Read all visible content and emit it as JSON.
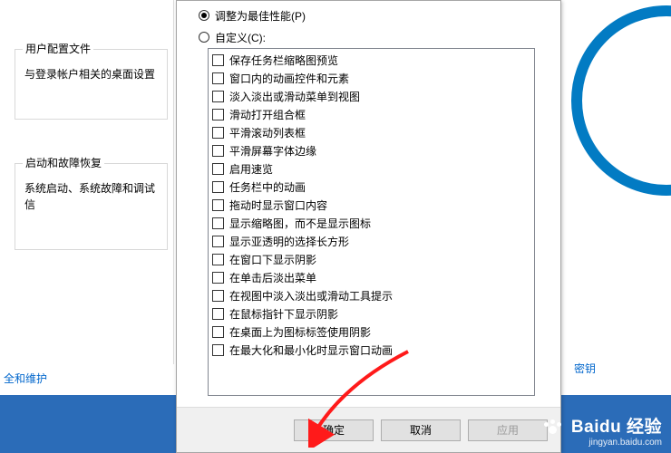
{
  "left": {
    "group1": {
      "title": "用户配置文件",
      "desc": "与登录帐户相关的桌面设置"
    },
    "group2": {
      "title": "启动和故障恢复",
      "desc": "系统启动、系统故障和调试信"
    }
  },
  "dialog": {
    "radios": {
      "best_perf": "调整为最佳性能(P)",
      "custom": "自定义(C):"
    },
    "options": [
      "保存任务栏缩略图预览",
      "窗口内的动画控件和元素",
      "淡入淡出或滑动菜单到视图",
      "滑动打开组合框",
      "平滑滚动列表框",
      "平滑屏幕字体边缘",
      "启用速览",
      "任务栏中的动画",
      "拖动时显示窗口内容",
      "显示缩略图，而不是显示图标",
      "显示亚透明的选择长方形",
      "在窗口下显示阴影",
      "在单击后淡出菜单",
      "在视图中淡入淡出或滑动工具提示",
      "在鼠标指针下显示阴影",
      "在桌面上为图标标签使用阴影",
      "在最大化和最小化时显示窗口动画"
    ],
    "buttons": {
      "ok": "确定",
      "cancel": "取消",
      "apply": "应用"
    }
  },
  "right": {
    "farlink": "密钥"
  },
  "bottom": {
    "link": "全和维护"
  },
  "watermark": {
    "brand_a": "Bai",
    "brand_b": "du",
    "brand_c": "经验",
    "url": "jingyan.baidu.com"
  }
}
